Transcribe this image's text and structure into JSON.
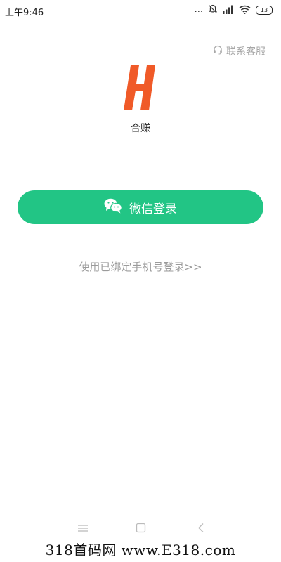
{
  "status_bar": {
    "time": "上午9:46",
    "dots": "...",
    "battery_level": "13"
  },
  "header": {
    "service_label": "联系客服"
  },
  "brand": {
    "logo_letter": "H",
    "logo_color": "#f05a28",
    "app_name": "合赚"
  },
  "login": {
    "wechat_button_label": "微信登录",
    "wechat_button_color": "#22c585",
    "phone_login_label": "使用已绑定手机号登录>>"
  },
  "watermark": {
    "text": "318首码网  www.E318.com"
  }
}
